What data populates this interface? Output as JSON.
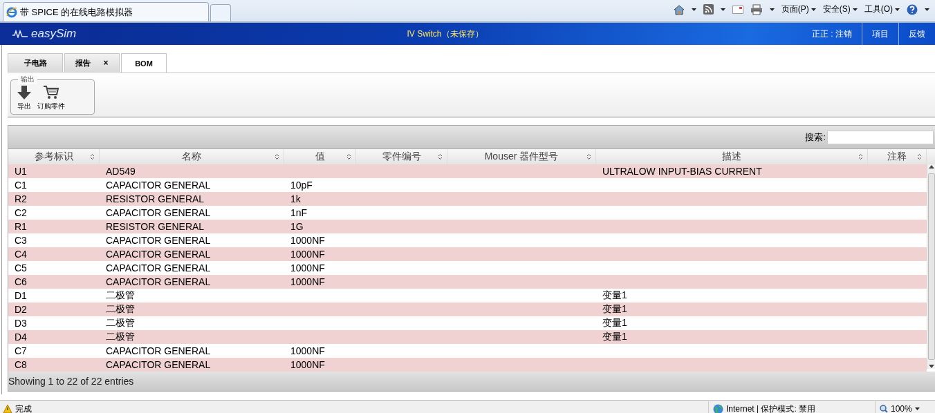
{
  "browser": {
    "tab_title": "带 SPICE 的在线电路模拟器",
    "menus": [
      "页面(P)",
      "安全(S)",
      "工具(O)"
    ]
  },
  "app": {
    "logo": "easySim",
    "title": "IV Switch（未保存）",
    "nav": [
      "正正 : 注销",
      "項目",
      "反馈"
    ]
  },
  "tabs": [
    {
      "label": "子电路",
      "selected": false
    },
    {
      "label": "报告",
      "selected": false,
      "close": "×"
    },
    {
      "label": "BOM",
      "selected": true
    }
  ],
  "toolbar": {
    "group": "输出",
    "buttons": [
      {
        "kind": "export",
        "label": "导出"
      },
      {
        "kind": "cart",
        "label": "订购零件"
      }
    ]
  },
  "search": {
    "label": "搜索:"
  },
  "table": {
    "columns": [
      "参考标识",
      "名称",
      "值",
      "零件编号",
      "Mouser 器件型号",
      "描述",
      "注释"
    ],
    "rows": [
      {
        "ref": "U1",
        "name": "AD549",
        "desc": "ULTRALOW INPUT-BIAS CURRENT"
      },
      {
        "ref": "C1",
        "name": "CAPACITOR GENERAL",
        "value": "10pF"
      },
      {
        "ref": "R2",
        "name": "RESISTOR GENERAL",
        "value": "1k"
      },
      {
        "ref": "C2",
        "name": "CAPACITOR GENERAL",
        "value": "1nF"
      },
      {
        "ref": "R1",
        "name": "RESISTOR GENERAL",
        "value": "1G"
      },
      {
        "ref": "C3",
        "name": "CAPACITOR GENERAL",
        "value": "1000NF"
      },
      {
        "ref": "C4",
        "name": "CAPACITOR GENERAL",
        "value": "1000NF"
      },
      {
        "ref": "C5",
        "name": "CAPACITOR GENERAL",
        "value": "1000NF"
      },
      {
        "ref": "C6",
        "name": "CAPACITOR GENERAL",
        "value": "1000NF"
      },
      {
        "ref": "D1",
        "name": "二极管",
        "desc": "变量1"
      },
      {
        "ref": "D2",
        "name": "二极管",
        "desc": "变量1"
      },
      {
        "ref": "D3",
        "name": "二极管",
        "desc": "变量1"
      },
      {
        "ref": "D4",
        "name": "二极管",
        "desc": "变量1"
      },
      {
        "ref": "C7",
        "name": "CAPACITOR GENERAL",
        "value": "1000NF"
      },
      {
        "ref": "C8",
        "name": "CAPACITOR GENERAL",
        "value": "1000NF"
      }
    ],
    "info": "Showing 1 to 22 of 22 entries"
  },
  "status": {
    "text": "完成",
    "zone": "Internet | 保护模式: 禁用",
    "zoom": "100%"
  }
}
